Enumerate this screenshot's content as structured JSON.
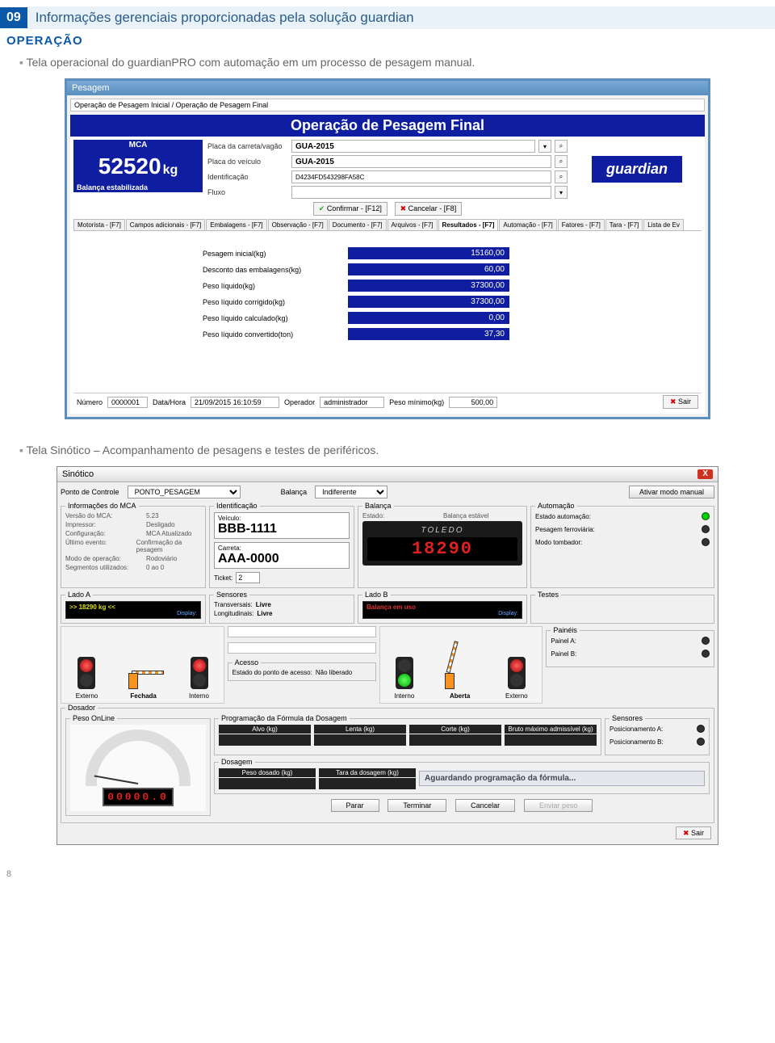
{
  "page": {
    "num": "09",
    "title": "Informações gerenciais proporcionadas pela solução guardian",
    "section": "OPERAÇÃO",
    "bullet1": "Tela operacional do guardianPRO com automação em um processo de pesagem manual.",
    "bullet2": "Tela Sinótico – Acompanhamento de pesagens e testes de periféricos.",
    "footer": "8"
  },
  "pesagem": {
    "win_title": "Pesagem",
    "path": "Operação de Pesagem Inicial / Operação de Pesagem Final",
    "op_title": "Operação de Pesagem Final",
    "mca_head": "MCA",
    "mca_weight": "52520",
    "mca_unit": "kg",
    "mca_status": "Balança estabilizada",
    "brand": "guardian",
    "fields": {
      "placa_carreta_lbl": "Placa da carreta/vagão",
      "placa_carreta_val": "GUA-2015",
      "placa_veiculo_lbl": "Placa do veículo",
      "placa_veiculo_val": "GUA-2015",
      "ident_lbl": "Identificação",
      "ident_val": "D4234FD543298FA58C",
      "fluxo_lbl": "Fluxo",
      "fluxo_val": ""
    },
    "btn_confirmar": "Confirmar - [F12]",
    "btn_cancelar": "Cancelar - [F8]",
    "tabs": [
      "Motorista - [F7]",
      "Campos adicionais - [F7]",
      "Embalagens - [F7]",
      "Observação - [F7]",
      "Documento - [F7]",
      "Arquivos - [F7]",
      "Resultados - [F7]",
      "Automação - [F7]",
      "Fatores - [F7]",
      "Tara - [F7]",
      "Lista de Ev"
    ],
    "results": [
      {
        "label": "Pesagem inicial(kg)",
        "value": "15160,00"
      },
      {
        "label": "Desconto das embalagens(kg)",
        "value": "60,00"
      },
      {
        "label": "Peso líquido(kg)",
        "value": "37300,00"
      },
      {
        "label": "Peso líquido corrigido(kg)",
        "value": "37300,00"
      },
      {
        "label": "Peso líquido calculado(kg)",
        "value": "0,00"
      },
      {
        "label": "Peso líquido convertido(ton)",
        "value": "37,30"
      }
    ],
    "bottom": {
      "numero_lbl": "Número",
      "numero_val": "0000001",
      "datahora_lbl": "Data/Hora",
      "datahora_val": "21/09/2015 16:10:59",
      "operador_lbl": "Operador",
      "operador_val": "administrador",
      "pesomin_lbl": "Peso mínimo(kg)",
      "pesomin_val": "500,00",
      "sair": "Sair"
    }
  },
  "sinotico": {
    "win_title": "Sinótico",
    "top": {
      "ponto_lbl": "Ponto de Controle",
      "ponto_val": "PONTO_PESAGEM",
      "balanca_lbl": "Balança",
      "balanca_val": "Indiferente",
      "ativar_btn": "Ativar modo manual"
    },
    "mca": {
      "legend": "Informações do MCA",
      "lines": [
        [
          "Versão do MCA:",
          "5.23"
        ],
        [
          "Impressor:",
          "Desligado"
        ],
        [
          "Configuração:",
          "MCA Atualizado"
        ],
        [
          "Último evento:",
          "Confirmação da pesagem"
        ],
        [
          "Modo de operação:",
          "Rodoviário"
        ],
        [
          "Segmentos utilizados:",
          "0 ao 0"
        ]
      ]
    },
    "ident": {
      "legend": "Identificação",
      "veiculo_lbl": "Veículo:",
      "veiculo_val": "BBB-1111",
      "carreta_lbl": "Carreta:",
      "carreta_val": "AAA-0000",
      "ticket_lbl": "Ticket:",
      "ticket_val": "2"
    },
    "bal": {
      "legend": "Balança",
      "estado_lbl": "Estado:",
      "estado_val": "Balança estável",
      "brand": "TOLEDO",
      "display": "18290"
    },
    "auto": {
      "legend": "Automação",
      "estado_lbl": "Estado automação:",
      "ferro_lbl": "Pesagem ferroviária:",
      "tomb_lbl": "Modo tombador:"
    },
    "ladoA": {
      "legend": "Lado A",
      "weight": ">>   18290 kg  <<",
      "display_lbl": "Display:"
    },
    "sensores": {
      "legend": "Sensores",
      "trans_lbl": "Transversais:",
      "trans_val": "Livre",
      "long_lbl": "Longitudinais:",
      "long_val": "Livre"
    },
    "ladoB": {
      "legend": "Lado B",
      "inuse": "Balança em uso",
      "display_lbl": "Display:"
    },
    "testes": {
      "legend": "Testes"
    },
    "lights": {
      "externo": "Externo",
      "fechada": "Fechada",
      "interno": "Interno",
      "aberta": "Aberta"
    },
    "acesso": {
      "legend": "Acesso",
      "estado_lbl": "Estado do ponto de acesso:",
      "estado_val": "Não liberado"
    },
    "paineis": {
      "legend": "Painéis",
      "a_lbl": "Painel A:",
      "b_lbl": "Painel B:"
    },
    "dosador": {
      "legend": "Dosador",
      "peso_online": "Peso OnLine",
      "gauge_disp": "00000.0",
      "prog_legend": "Programação da Fórmula da Dosagem",
      "cols": [
        "Alvo (kg)",
        "Lenta (kg)",
        "Corte (kg)",
        "Bruto máximo admissível (kg)"
      ],
      "sens_legend": "Sensores",
      "sens_a": "Posicionamento A:",
      "sens_b": "Posicionamento B:",
      "dosagem_legend": "Dosagem",
      "peso_dosado": "Peso dosado (kg)",
      "tara_dosagem": "Tara da dosagem (kg)",
      "status": "Aguardando programação da fórmula...",
      "btn_parar": "Parar",
      "btn_terminar": "Terminar",
      "btn_cancelar": "Cancelar",
      "btn_enviar": "Enviar peso"
    },
    "sair": "Sair"
  }
}
